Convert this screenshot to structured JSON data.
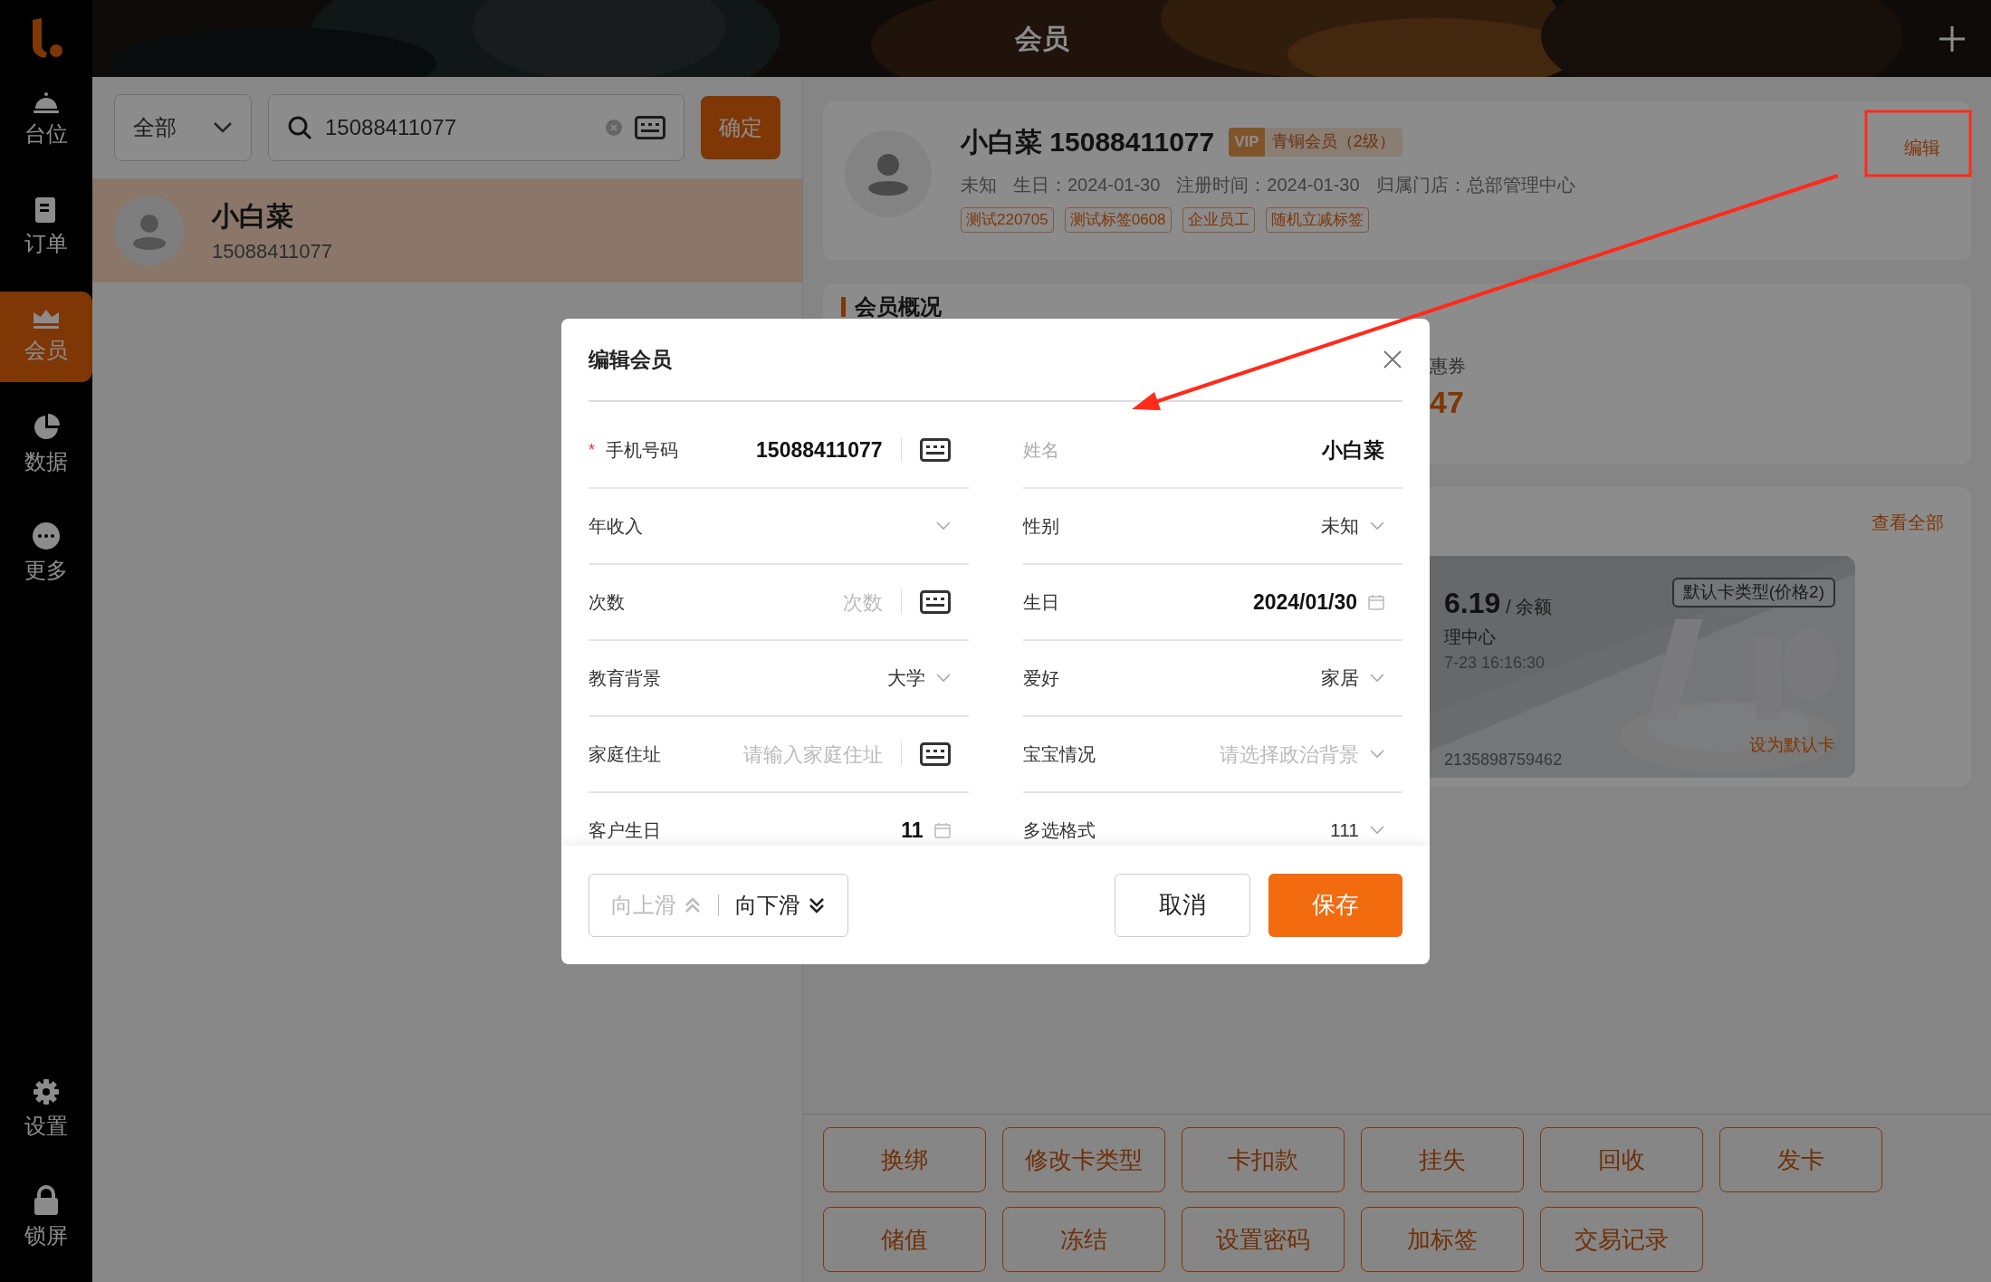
{
  "header": {
    "title": "会员"
  },
  "sidebar": {
    "items": [
      {
        "label": "台位",
        "kind": "bell",
        "selected": false
      },
      {
        "label": "订单",
        "kind": "order",
        "selected": false
      },
      {
        "label": "会员",
        "kind": "member",
        "selected": true
      },
      {
        "label": "数据",
        "kind": "chart",
        "selected": false
      },
      {
        "label": "更多",
        "kind": "more",
        "selected": false
      }
    ],
    "bottom_items": [
      {
        "label": "设置",
        "kind": "settings",
        "selected": false
      },
      {
        "label": "锁屏",
        "kind": "lock",
        "selected": false
      }
    ]
  },
  "left_panel": {
    "filter": {
      "value": "全部"
    },
    "search": {
      "value": "15088411077"
    },
    "confirm_button": "确定",
    "members": [
      {
        "name": "小白菜",
        "phone": "15088411077",
        "selected": true
      }
    ]
  },
  "member": {
    "name": "小白菜 15088411077",
    "vip_badge": "VIP",
    "level": "青铜会员（2级）",
    "info": [
      "未知",
      "生日：2024-01-30",
      "注册时间：2024-01-30",
      "归属门店：总部管理中心"
    ],
    "tags": [
      "测试220705",
      "测试标签0608",
      "企业员工",
      "随机立减标签"
    ],
    "edit_link": "编辑"
  },
  "overview": {
    "title": "会员概况",
    "coupon_label": "惠券",
    "coupon_value": "47"
  },
  "cards": {
    "view_all": "查看全部",
    "amount": "6.19",
    "amount_label": "/ 余额",
    "store": "理中心",
    "time": "7-23 16:16:30",
    "number": "2135898759462",
    "type_badge": "默认卡类型(价格2)",
    "set_default": "设为默认卡"
  },
  "actions": [
    "换绑",
    "修改卡类型",
    "卡扣款",
    "挂失",
    "回收",
    "发卡",
    "储值",
    "冻结",
    "设置密码",
    "加标签",
    "交易记录"
  ],
  "modal": {
    "title": "编辑会员",
    "fields": [
      {
        "label": "手机号码",
        "kind": "keyboard",
        "value": "15088411077",
        "required_mark": "*",
        "disabled": false
      },
      {
        "label": "姓名",
        "kind": "text",
        "value": "小白菜",
        "disabled": true
      },
      {
        "label": "年收入",
        "kind": "select",
        "disabled": false
      },
      {
        "label": "性别",
        "kind": "select",
        "value": "未知",
        "disabled": false
      },
      {
        "label": "次数",
        "kind": "keyboard",
        "placeholder": "次数",
        "disabled": false
      },
      {
        "label": "生日",
        "kind": "date",
        "value": "2024/01/30",
        "disabled": false
      },
      {
        "label": "教育背景",
        "kind": "select",
        "value": "大学",
        "disabled": false
      },
      {
        "label": "爱好",
        "kind": "select",
        "value": "家居",
        "disabled": false
      },
      {
        "label": "家庭住址",
        "kind": "keyboard",
        "placeholder": "请输入家庭住址",
        "disabled": false
      },
      {
        "label": "宝宝情况",
        "kind": "select",
        "placeholder": "请选择政治背景",
        "disabled": false
      },
      {
        "label": "客户生日",
        "kind": "date",
        "value": "11",
        "disabled": false
      },
      {
        "label": "多选格式",
        "kind": "select",
        "value": "111",
        "disabled": false
      }
    ],
    "scroll_up": {
      "label": "向上滑",
      "disabled": true
    },
    "scroll_down": {
      "label": "向下滑",
      "disabled": false
    },
    "cancel_button": "取消",
    "save_button": "保存"
  }
}
